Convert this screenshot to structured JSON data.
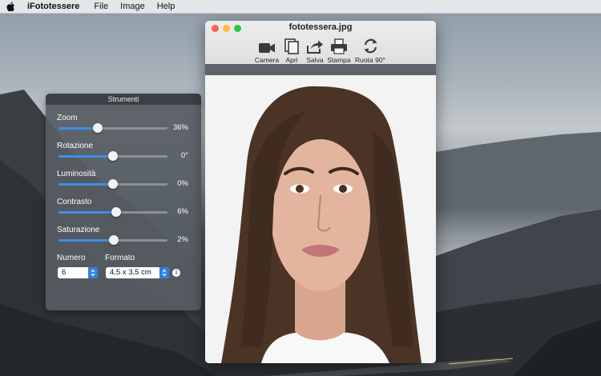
{
  "menubar": {
    "app_name": "iFototessere",
    "items": [
      "File",
      "Image",
      "Help"
    ]
  },
  "tools_panel": {
    "title": "Strumenti",
    "controls": [
      {
        "label": "Zoom",
        "value_text": "36%",
        "position": 0.36
      },
      {
        "label": "Rotazione",
        "value_text": "0°",
        "position": 0.5
      },
      {
        "label": "Luminosità",
        "value_text": "0%",
        "position": 0.5
      },
      {
        "label": "Contrasto",
        "value_text": "6%",
        "position": 0.53
      },
      {
        "label": "Saturazione",
        "value_text": "2%",
        "position": 0.51
      }
    ],
    "numero_label": "Numero",
    "numero_value": "6",
    "formato_label": "Formato",
    "formato_value": "4,5 x 3,5 cm"
  },
  "image_window": {
    "title": "fototessera.jpg",
    "toolbar": [
      {
        "label": "Camera",
        "icon": "video-camera-icon"
      },
      {
        "label": "Apri",
        "icon": "open-file-icon"
      },
      {
        "label": "Salva",
        "icon": "share-save-icon"
      },
      {
        "label": "Stampa",
        "icon": "printer-icon"
      },
      {
        "label": "Ruota 90°",
        "icon": "rotate-icon"
      }
    ]
  },
  "colors": {
    "accent": "#3e8ee8",
    "panel_bg": "#565c63",
    "close": "#fc5f57",
    "minimize": "#fdbc2e",
    "zoom": "#28c840"
  }
}
